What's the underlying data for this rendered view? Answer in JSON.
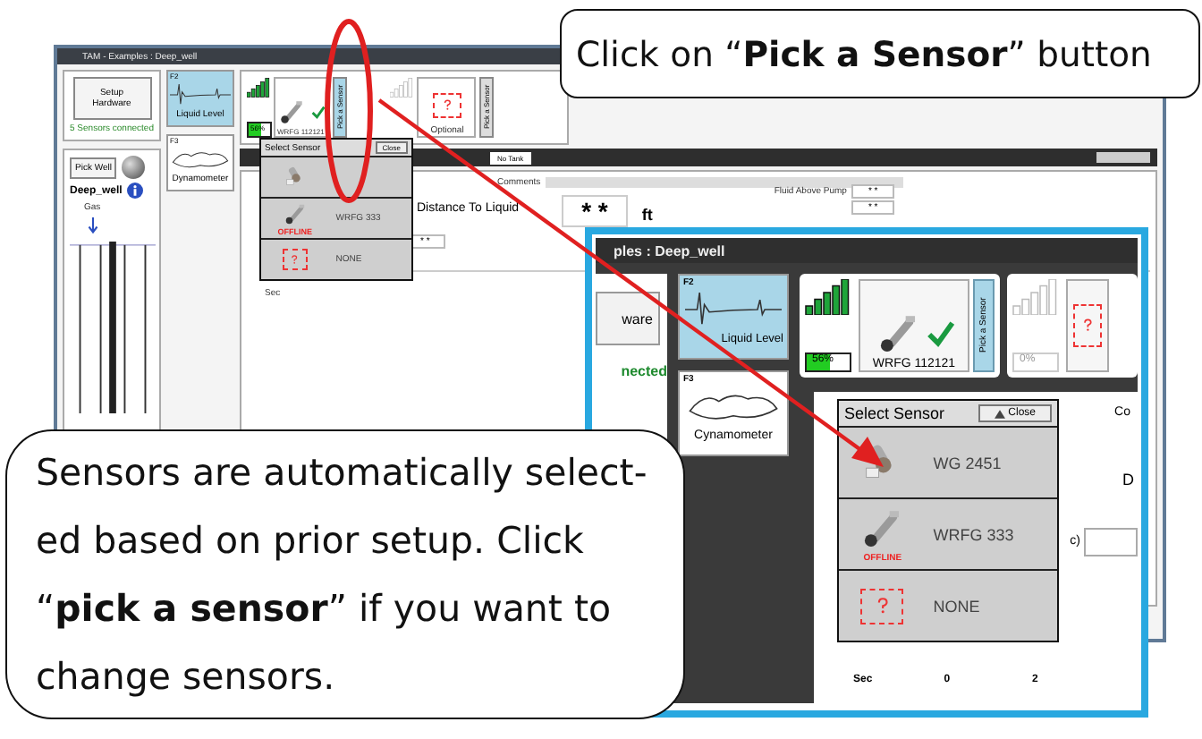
{
  "window": {
    "title": "TAM - Examples : Deep_well",
    "setup_button": "Setup Hardware",
    "sensors_status": "5 Sensors connected",
    "pick_well": "Pick Well",
    "well_name": "Deep_well",
    "gas_label": "Gas",
    "functions": [
      {
        "key": "F2",
        "label": "Liquid Level",
        "selected": true
      },
      {
        "key": "F3",
        "label": "Dynamometer",
        "selected": false
      }
    ],
    "sensor_slots": [
      {
        "kind": "sensor",
        "name": "WRFG 112121",
        "battery": "56%",
        "level": 0.56,
        "pick_label": "Pick a Sensor"
      },
      {
        "kind": "empty",
        "name": "Optional",
        "pick_label": "Pick a Sensor"
      }
    ],
    "popup": {
      "title": "Select Sensor",
      "close": "Close",
      "items": [
        {
          "kind": "online"
        },
        {
          "kind": "offline",
          "name": "WRFG 333",
          "status": "OFFLINE"
        },
        {
          "kind": "none",
          "name": "NONE"
        }
      ]
    },
    "tab": "No Tank",
    "comments_label": "Comments",
    "distance_label": "Distance To Liquid",
    "distance_value": "* *",
    "distance_unit": "ft",
    "small_value": "* *",
    "fields": [
      {
        "label": "Fluid Above Pump",
        "value": "* *"
      },
      {
        "value": "* *"
      }
    ],
    "chart_axis": "Sec"
  },
  "inset": {
    "title": "ples : Deep_well",
    "hardware_button": "ware",
    "sensors_status": "nected",
    "functions": [
      {
        "key": "F2",
        "label": "Liquid Level",
        "selected": true
      },
      {
        "key": "F3",
        "label": "Cynamometer",
        "selected": false
      }
    ],
    "sensor": {
      "battery": "56%",
      "level": 0.56,
      "name": "WRFG 112121",
      "pick_label": "Pick a Sensor"
    },
    "second_sensor": {
      "battery": "0%",
      "level": 0
    },
    "popup": {
      "title": "Select Sensor",
      "close": "Close",
      "items": [
        {
          "kind": "online",
          "name": "WG 2451"
        },
        {
          "kind": "offline",
          "name": "WRFG 333",
          "status": "OFFLINE"
        },
        {
          "kind": "none",
          "name": "NONE"
        }
      ]
    },
    "labels": [
      "Co",
      "D",
      "c)"
    ],
    "axis": [
      "Sec",
      "0",
      "2"
    ]
  },
  "callouts": [
    {
      "text": "Click on “**Pick a Sensor**” button"
    },
    {
      "text": "Sensors are automatically select-\ned based on prior setup. Click\n“**pick a sensor**” if you want to\nchange sensors."
    }
  ]
}
